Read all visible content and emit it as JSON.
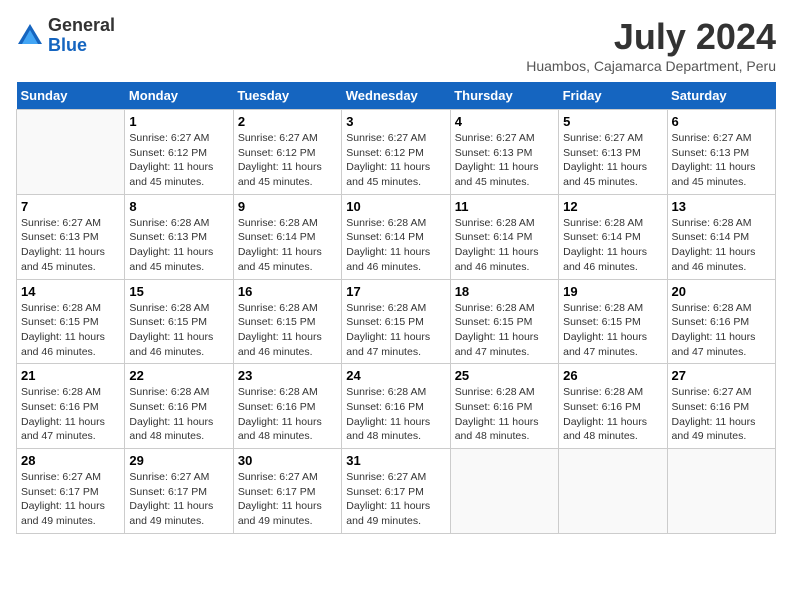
{
  "logo": {
    "general": "General",
    "blue": "Blue"
  },
  "title": "July 2024",
  "subtitle": "Huambos, Cajamarca Department, Peru",
  "days_of_week": [
    "Sunday",
    "Monday",
    "Tuesday",
    "Wednesday",
    "Thursday",
    "Friday",
    "Saturday"
  ],
  "weeks": [
    [
      {
        "day": "",
        "info": ""
      },
      {
        "day": "1",
        "info": "Sunrise: 6:27 AM\nSunset: 6:12 PM\nDaylight: 11 hours\nand 45 minutes."
      },
      {
        "day": "2",
        "info": "Sunrise: 6:27 AM\nSunset: 6:12 PM\nDaylight: 11 hours\nand 45 minutes."
      },
      {
        "day": "3",
        "info": "Sunrise: 6:27 AM\nSunset: 6:12 PM\nDaylight: 11 hours\nand 45 minutes."
      },
      {
        "day": "4",
        "info": "Sunrise: 6:27 AM\nSunset: 6:13 PM\nDaylight: 11 hours\nand 45 minutes."
      },
      {
        "day": "5",
        "info": "Sunrise: 6:27 AM\nSunset: 6:13 PM\nDaylight: 11 hours\nand 45 minutes."
      },
      {
        "day": "6",
        "info": "Sunrise: 6:27 AM\nSunset: 6:13 PM\nDaylight: 11 hours\nand 45 minutes."
      }
    ],
    [
      {
        "day": "7",
        "info": "Sunrise: 6:27 AM\nSunset: 6:13 PM\nDaylight: 11 hours\nand 45 minutes."
      },
      {
        "day": "8",
        "info": "Sunrise: 6:28 AM\nSunset: 6:13 PM\nDaylight: 11 hours\nand 45 minutes."
      },
      {
        "day": "9",
        "info": "Sunrise: 6:28 AM\nSunset: 6:14 PM\nDaylight: 11 hours\nand 45 minutes."
      },
      {
        "day": "10",
        "info": "Sunrise: 6:28 AM\nSunset: 6:14 PM\nDaylight: 11 hours\nand 46 minutes."
      },
      {
        "day": "11",
        "info": "Sunrise: 6:28 AM\nSunset: 6:14 PM\nDaylight: 11 hours\nand 46 minutes."
      },
      {
        "day": "12",
        "info": "Sunrise: 6:28 AM\nSunset: 6:14 PM\nDaylight: 11 hours\nand 46 minutes."
      },
      {
        "day": "13",
        "info": "Sunrise: 6:28 AM\nSunset: 6:14 PM\nDaylight: 11 hours\nand 46 minutes."
      }
    ],
    [
      {
        "day": "14",
        "info": "Sunrise: 6:28 AM\nSunset: 6:15 PM\nDaylight: 11 hours\nand 46 minutes."
      },
      {
        "day": "15",
        "info": "Sunrise: 6:28 AM\nSunset: 6:15 PM\nDaylight: 11 hours\nand 46 minutes."
      },
      {
        "day": "16",
        "info": "Sunrise: 6:28 AM\nSunset: 6:15 PM\nDaylight: 11 hours\nand 46 minutes."
      },
      {
        "day": "17",
        "info": "Sunrise: 6:28 AM\nSunset: 6:15 PM\nDaylight: 11 hours\nand 47 minutes."
      },
      {
        "day": "18",
        "info": "Sunrise: 6:28 AM\nSunset: 6:15 PM\nDaylight: 11 hours\nand 47 minutes."
      },
      {
        "day": "19",
        "info": "Sunrise: 6:28 AM\nSunset: 6:15 PM\nDaylight: 11 hours\nand 47 minutes."
      },
      {
        "day": "20",
        "info": "Sunrise: 6:28 AM\nSunset: 6:16 PM\nDaylight: 11 hours\nand 47 minutes."
      }
    ],
    [
      {
        "day": "21",
        "info": "Sunrise: 6:28 AM\nSunset: 6:16 PM\nDaylight: 11 hours\nand 47 minutes."
      },
      {
        "day": "22",
        "info": "Sunrise: 6:28 AM\nSunset: 6:16 PM\nDaylight: 11 hours\nand 48 minutes."
      },
      {
        "day": "23",
        "info": "Sunrise: 6:28 AM\nSunset: 6:16 PM\nDaylight: 11 hours\nand 48 minutes."
      },
      {
        "day": "24",
        "info": "Sunrise: 6:28 AM\nSunset: 6:16 PM\nDaylight: 11 hours\nand 48 minutes."
      },
      {
        "day": "25",
        "info": "Sunrise: 6:28 AM\nSunset: 6:16 PM\nDaylight: 11 hours\nand 48 minutes."
      },
      {
        "day": "26",
        "info": "Sunrise: 6:28 AM\nSunset: 6:16 PM\nDaylight: 11 hours\nand 48 minutes."
      },
      {
        "day": "27",
        "info": "Sunrise: 6:27 AM\nSunset: 6:16 PM\nDaylight: 11 hours\nand 49 minutes."
      }
    ],
    [
      {
        "day": "28",
        "info": "Sunrise: 6:27 AM\nSunset: 6:17 PM\nDaylight: 11 hours\nand 49 minutes."
      },
      {
        "day": "29",
        "info": "Sunrise: 6:27 AM\nSunset: 6:17 PM\nDaylight: 11 hours\nand 49 minutes."
      },
      {
        "day": "30",
        "info": "Sunrise: 6:27 AM\nSunset: 6:17 PM\nDaylight: 11 hours\nand 49 minutes."
      },
      {
        "day": "31",
        "info": "Sunrise: 6:27 AM\nSunset: 6:17 PM\nDaylight: 11 hours\nand 49 minutes."
      },
      {
        "day": "",
        "info": ""
      },
      {
        "day": "",
        "info": ""
      },
      {
        "day": "",
        "info": ""
      }
    ]
  ]
}
